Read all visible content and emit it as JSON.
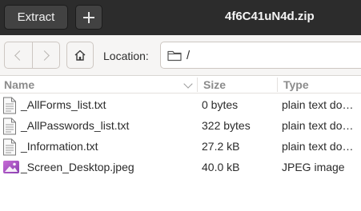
{
  "header": {
    "extract_label": "Extract",
    "add_icon": "plus-icon",
    "title": "4f6C41uN4d.zip",
    "background": "#2c2c2c"
  },
  "toolbar": {
    "back_icon": "chevron-left-icon",
    "forward_icon": "chevron-right-icon",
    "home_icon": "home-icon",
    "location_label": "Location:",
    "location_icon": "folder-icon",
    "location_value": "/"
  },
  "columns": {
    "name": "Name",
    "size": "Size",
    "type": "Type"
  },
  "files": [
    {
      "name": "_AllForms_list.txt",
      "size": "0 bytes",
      "type": "plain text document",
      "icon": "text-file-icon"
    },
    {
      "name": "_AllPasswords_list.txt",
      "size": "322 bytes",
      "type": "plain text document",
      "icon": "text-file-icon"
    },
    {
      "name": "_Information.txt",
      "size": "27.2 kB",
      "type": "plain text document",
      "icon": "text-file-icon"
    },
    {
      "name": "_Screen_Desktop.jpeg",
      "size": "40.0 kB",
      "type": "JPEG image",
      "icon": "image-file-icon"
    }
  ]
}
